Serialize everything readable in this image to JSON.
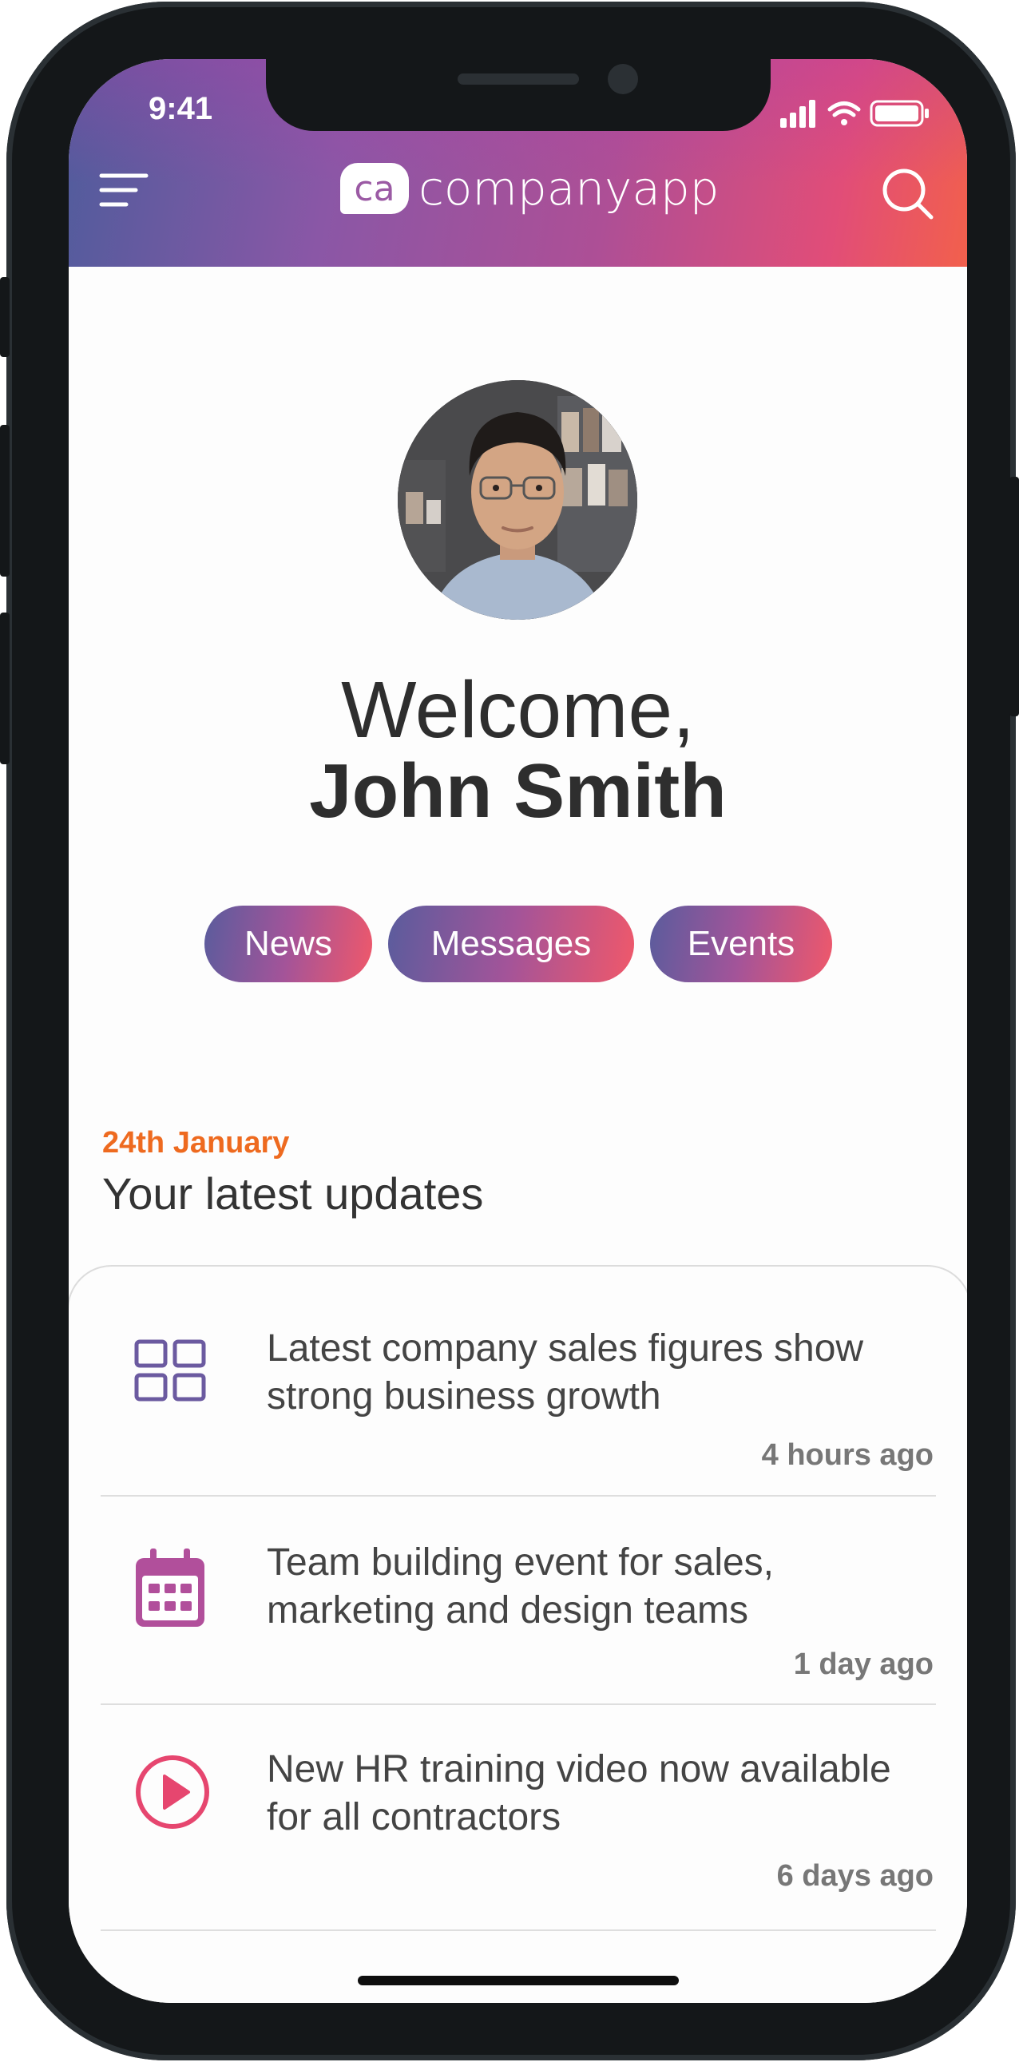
{
  "status_bar": {
    "time": "9:41"
  },
  "header": {
    "logo_badge": "ca",
    "logo_text": "companyapp"
  },
  "profile": {
    "greeting": "Welcome,",
    "name": "John Smith"
  },
  "quick_links": [
    {
      "label": "News"
    },
    {
      "label": "Messages"
    },
    {
      "label": "Events"
    }
  ],
  "updates_section": {
    "date": "24th January",
    "title": "Your latest updates",
    "items": [
      {
        "icon": "grid-icon",
        "text": "Latest company sales figures show strong business growth",
        "time": "4 hours ago"
      },
      {
        "icon": "calendar-icon",
        "text": "Team building event for sales, marketing and design teams",
        "time": "1 day ago"
      },
      {
        "icon": "play-icon",
        "text": "New HR training video now available for all contractors",
        "time": "6 days ago"
      }
    ]
  },
  "colors": {
    "accent_orange": "#ee6a1f",
    "icon_purple": "#6b5aa0",
    "icon_magenta": "#b14f9b",
    "icon_pink": "#e6466f"
  }
}
